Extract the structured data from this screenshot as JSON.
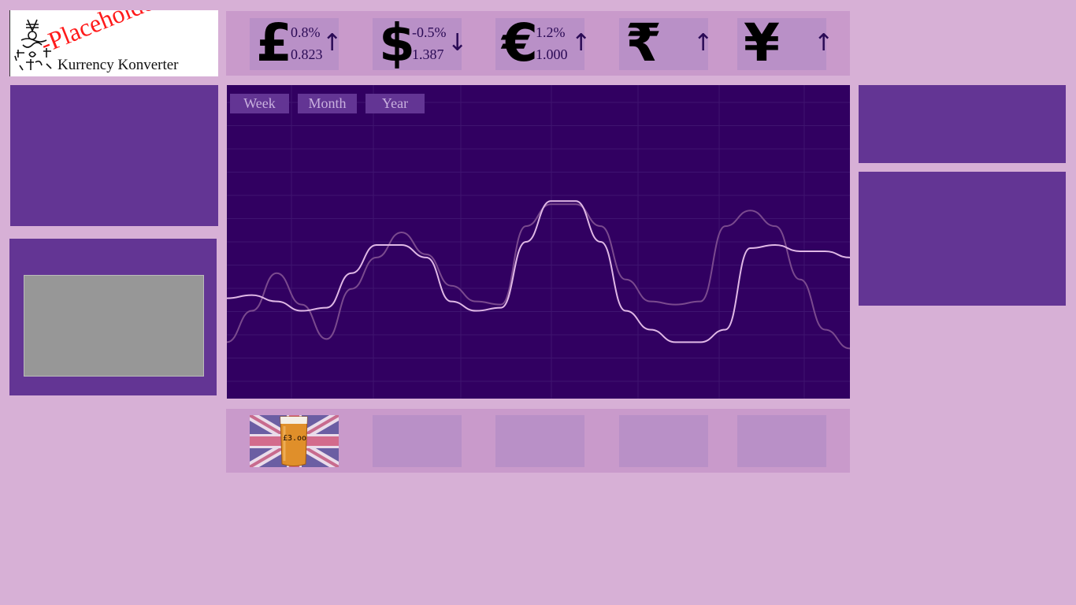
{
  "logo": {
    "title": "-Placeholder-",
    "subtitle": "Kurrency Konverter",
    "glyph_icon": "currency-symbols-glyph"
  },
  "tickers": [
    {
      "symbol": "£",
      "icon": "pound-icon",
      "change": "0.8%",
      "rate": "0.823",
      "arrow": "↑",
      "direction": "up"
    },
    {
      "symbol": "$",
      "icon": "dollar-icon",
      "change": "-0.5%",
      "rate": "1.387",
      "arrow": "↓",
      "direction": "down"
    },
    {
      "symbol": "€",
      "icon": "euro-icon",
      "change": "1.2%",
      "rate": "1.000",
      "arrow": "↑",
      "direction": "up"
    },
    {
      "symbol": "₹",
      "icon": "rupee-icon",
      "change": "",
      "rate": "",
      "arrow": "↑",
      "direction": "up"
    },
    {
      "symbol": "¥",
      "icon": "yen-icon",
      "change": "",
      "rate": "",
      "arrow": "↑",
      "direction": "up"
    }
  ],
  "chart": {
    "range_buttons": [
      "Week",
      "Month",
      "Year"
    ]
  },
  "chart_data": {
    "type": "line",
    "title": "",
    "xlabel": "",
    "ylabel": "",
    "grid": true,
    "series": [
      {
        "color": "#e0b8e6",
        "values": [
          0.32,
          0.33,
          0.31,
          0.28,
          0.29,
          0.4,
          0.49,
          0.49,
          0.45,
          0.31,
          0.28,
          0.29,
          0.5,
          0.63,
          0.63,
          0.5,
          0.28,
          0.22,
          0.18,
          0.18,
          0.22,
          0.48,
          0.49,
          0.47,
          0.47,
          0.45
        ]
      },
      {
        "color": "#7a4a8e",
        "values": [
          0.18,
          0.28,
          0.4,
          0.3,
          0.19,
          0.35,
          0.45,
          0.53,
          0.46,
          0.36,
          0.31,
          0.3,
          0.55,
          0.62,
          0.62,
          0.55,
          0.38,
          0.31,
          0.3,
          0.31,
          0.55,
          0.6,
          0.55,
          0.38,
          0.22,
          0.16
        ]
      }
    ]
  },
  "bottom": {
    "promo_price": "£3.oo",
    "flag_icon": "uk-flag-icon",
    "beer_icon": "beer-glass-icon"
  },
  "colors": {
    "background": "#d7b0d6",
    "panel": "#633594",
    "chart_bg": "#310061",
    "bar": "#c99acb",
    "tile": "#b990c7"
  }
}
